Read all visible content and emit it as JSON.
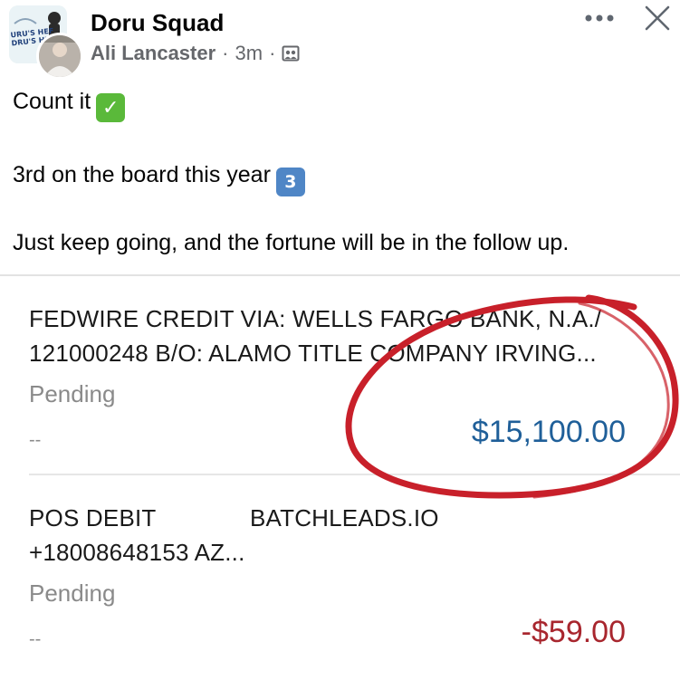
{
  "post": {
    "group_name": "Doru Squad",
    "author": "Ali Lancaster",
    "time": "3m",
    "separator": "·",
    "logo_text_line1": "URU'S HEF",
    "logo_text_line2": "DRU'S HI",
    "text_line1": "Count it",
    "text_line2": "3rd on the board this year",
    "text_line3": "Just keep going, and the fortune will be in the follow up.",
    "emoji_check": "✓",
    "emoji_three": "3",
    "more_icon": "more-horizontal-icon",
    "close_icon": "close-icon",
    "privacy_icon": "group-privacy-icon"
  },
  "transactions": [
    {
      "line1": "FEDWIRE CREDIT VIA: WELLS FARGO BANK, N.A./",
      "line2": "121000248 B/O: ALAMO TITLE COMPANY IRVING...",
      "status": "Pending",
      "dash": "--",
      "amount": "$15,100.00",
      "kind": "credit"
    },
    {
      "line1": "POS DEBIT              BATCHLEADS.IO",
      "line2": "+18008648153 AZ...",
      "status": "Pending",
      "dash": "--",
      "amount": "-$59.00",
      "kind": "debit"
    }
  ],
  "colors": {
    "credit": "#1f5f99",
    "debit": "#a8262e",
    "annotation_circle": "#c8202a",
    "meta_gray": "#65676b"
  }
}
